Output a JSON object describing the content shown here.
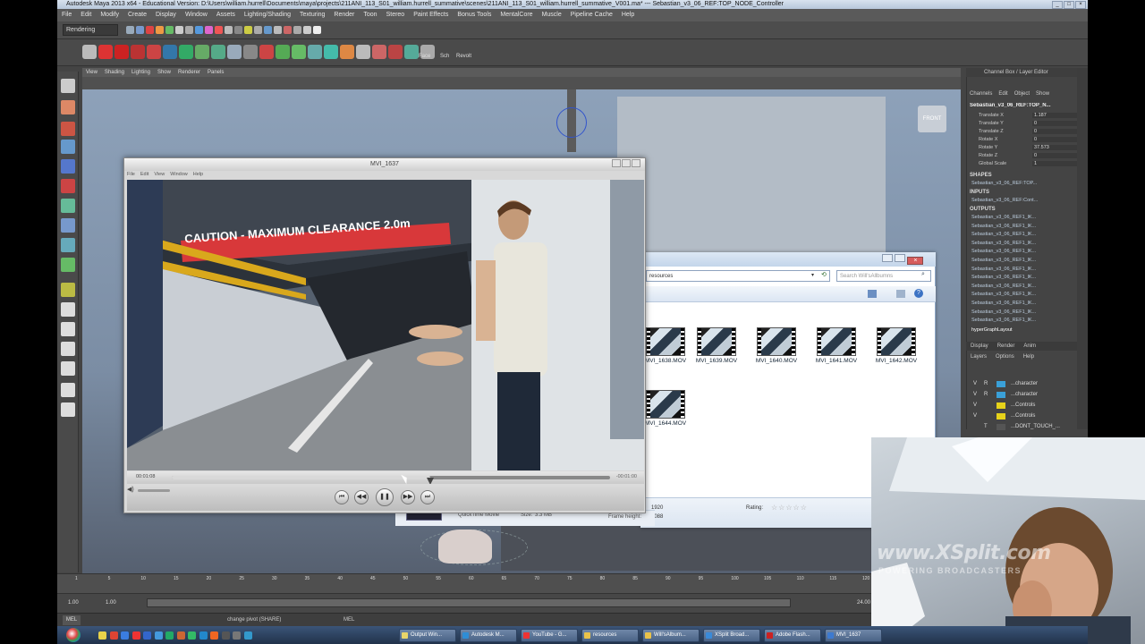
{
  "maya": {
    "title": "Autodesk Maya 2013 x64 - Educational Version: D:\\Users\\william.hurrell\\Documents\\maya\\projects\\211ANI_113_S01_william.hurrell_summative\\scenes\\211ANI_113_S01_william.hurrell_summative_V001.ma* --- Sebastian_v3_06_REF:TOP_NODE_Controller",
    "menus": [
      "File",
      "Edit",
      "Modify",
      "Create",
      "Display",
      "Window",
      "Assets",
      "Lighting/Shading",
      "Texturing",
      "Render",
      "Toon",
      "Stereo",
      "Paint Effects",
      "Bonus Tools",
      "MentalCore",
      "Muscle",
      "Pipeline Cache",
      "Help"
    ],
    "mode": "Rendering",
    "viewport_menus": [
      "View",
      "Shading",
      "Lighting",
      "Show",
      "Renderer",
      "Panels"
    ],
    "shelf_labels": [
      "Face",
      "Sch",
      "Revolt"
    ],
    "view_cube": "FRONT"
  },
  "channel_box": {
    "title": "Channel Box / Layer Editor",
    "tabs": [
      "Channels",
      "Edit",
      "Object",
      "Show"
    ],
    "object": "Sebastian_v3_06_REF:TOP_N...",
    "attributes": [
      {
        "name": "Translate X",
        "value": "1.187"
      },
      {
        "name": "Translate Y",
        "value": "0"
      },
      {
        "name": "Translate Z",
        "value": "0"
      },
      {
        "name": "Rotate X",
        "value": "0"
      },
      {
        "name": "Rotate Y",
        "value": "37.573"
      },
      {
        "name": "Rotate Z",
        "value": "0"
      },
      {
        "name": "Global Scale",
        "value": "1"
      }
    ],
    "shapes_label": "SHAPES",
    "shape": "Sebastian_v3_06_REF:TOP...",
    "inputs_label": "INPUTS",
    "input": "Sebastian_v3_06_REF:Cont...",
    "outputs_label": "OUTPUTS",
    "outputs": [
      "Sebastian_v3_06_REF1_lK...",
      "Sebastian_v3_06_REF1_lK...",
      "Sebastian_v3_06_REF1_lK...",
      "Sebastian_v3_06_REF1_lK...",
      "Sebastian_v3_06_REF1_lK...",
      "Sebastian_v3_06_REF1_lK...",
      "Sebastian_v3_06_REF1_lK...",
      "Sebastian_v3_06_REF1_lK...",
      "Sebastian_v3_06_REF1_lK...",
      "Sebastian_v3_06_REF1_lK...",
      "Sebastian_v3_06_REF1_lK...",
      "Sebastian_v3_06_REF1_lK...",
      "Sebastian_v3_06_REF1_lK..."
    ],
    "hyper": "hyperGraphLayout",
    "layer_tabs": [
      "Display",
      "Render",
      "Anim"
    ],
    "layer_menu": [
      "Layers",
      "Options",
      "Help"
    ],
    "layers": [
      {
        "v": "V",
        "p": "R",
        "color": "#3aa0d8",
        "name": "...character"
      },
      {
        "v": "V",
        "p": "R",
        "color": "#3aa0d8",
        "name": "...character"
      },
      {
        "v": "V",
        "p": "",
        "color": "#e6d21a",
        "name": "...Controls"
      },
      {
        "v": "V",
        "p": "",
        "color": "#e6d21a",
        "name": "...Controls"
      },
      {
        "v": "",
        "p": "T",
        "color": "#555555",
        "name": "...DONT_TOUCH_..."
      }
    ]
  },
  "timeline": {
    "ticks": [
      "1",
      "5",
      "10",
      "15",
      "20",
      "25",
      "30",
      "35",
      "40",
      "45",
      "50",
      "55",
      "60",
      "65",
      "70",
      "75",
      "80",
      "85",
      "90",
      "95",
      "100",
      "105",
      "110",
      "115",
      "120"
    ],
    "range_start": "1.00",
    "range_inner": "1.00",
    "range_end": "24.00",
    "command_label": "MEL",
    "command_text": "change pivot (SHARE)",
    "result_label": "MEL"
  },
  "quicktime": {
    "title": "MVI_1637",
    "menus": [
      "File",
      "Edit",
      "View",
      "Window",
      "Help"
    ],
    "current_time": "00:01:08",
    "remaining": "-00:01:00",
    "progress": 0.59,
    "caution_text": "CAUTION - MAXIMUM CLEARANCE 2.0m"
  },
  "explorer": {
    "address": "resources",
    "search_placeholder": "Search Will'sAllbumns",
    "files": [
      "MVI_1638.MOV",
      "MVI_1639.MOV",
      "MVI_1640.MOV",
      "MVI_1641.MOV",
      "MVI_1642.MOV",
      "MVI_1644.MOV"
    ],
    "details": {
      "type": "QuickTime Movie",
      "size_label": "Size:",
      "size": "3.3 MB",
      "frame_height_label": "Frame height:",
      "frame_width": "1920",
      "frame_height": "1088",
      "rating_label": "Rating:"
    }
  },
  "taskbar": {
    "buttons": [
      "Output Win...",
      "Autodesk M...",
      "YouTube - G...",
      "resources",
      "Will'sAlbum...",
      "XSplit Broad...",
      "Adobe Flash...",
      "MVI_1637"
    ]
  },
  "overlay": {
    "brand": "www.XSplit.com",
    "tagline": "POWERING BROADCASTERS"
  }
}
